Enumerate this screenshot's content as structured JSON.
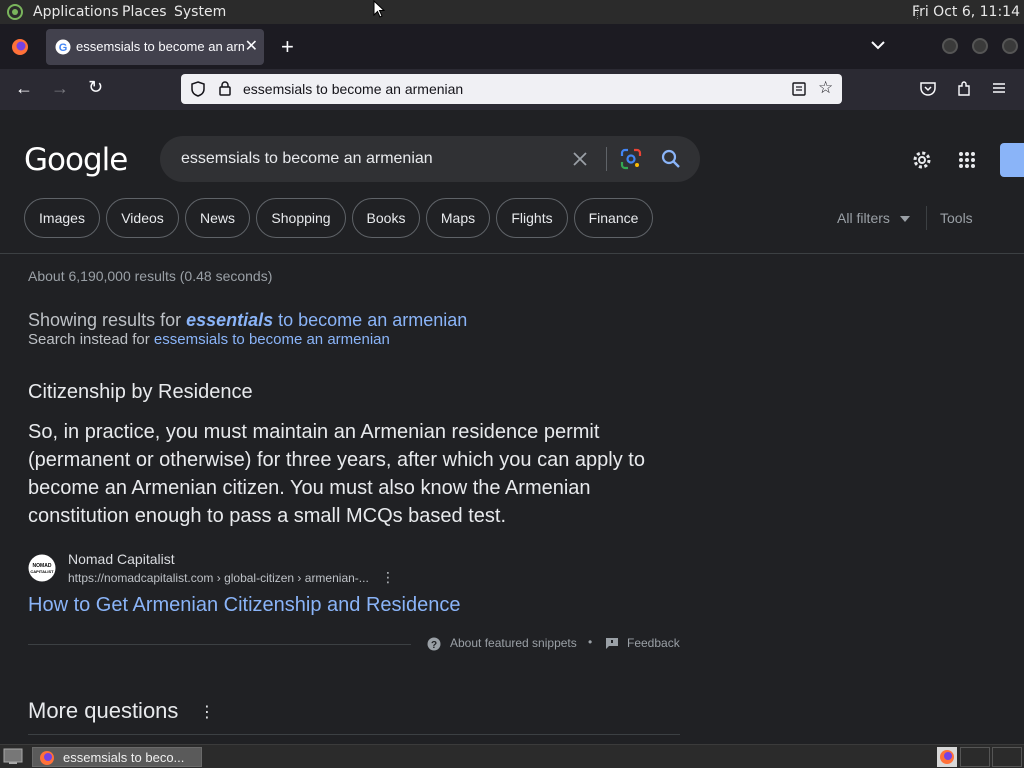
{
  "topbar": {
    "menus": [
      "Applications",
      "Places",
      "System"
    ],
    "clock": "Fri Oct  6, 11:14"
  },
  "browser": {
    "tab_title": "essemsials to become an armenian",
    "url": "essemsials to become an armenian"
  },
  "google": {
    "logo": "Google",
    "query": "essemsials to become an armenian",
    "chips": [
      "Images",
      "Videos",
      "News",
      "Shopping",
      "Books",
      "Maps",
      "Flights",
      "Finance"
    ],
    "all_filters": "All filters",
    "tools": "Tools",
    "result_stats": "About 6,190,000 results (0.48 seconds)",
    "showing_prefix": "Showing results for ",
    "showing_bold": "essentials",
    "showing_rest": " to become an armenian",
    "instead_prefix": "Search instead for ",
    "instead_link": "essemsials to become an armenian",
    "snippet_heading": "Citizenship by Residence",
    "snippet_text": "So, in practice, you must maintain an Armenian residence permit (permanent or otherwise) for three years, after which you can apply to become an Armenian citizen. You must also know the Armenian constitution enough to pass a small MCQs based test.",
    "source_name": "Nomad Capitalist",
    "source_url": "https://nomadcapitalist.com › global-citizen › armenian-...",
    "source_favicon_text": "NOMAD CAPITALIST",
    "result_title": "How to Get Armenian Citizenship and Residence",
    "about_snippets": "About featured snippets",
    "bullet": "•",
    "feedback": "Feedback",
    "more_questions": "More questions"
  },
  "taskbar": {
    "window_title": "essemsials to beco..."
  },
  "colors": {
    "page_bg": "#202124",
    "link": "#8ab4f8",
    "text": "#e8eaed",
    "muted": "#9aa0a6"
  }
}
